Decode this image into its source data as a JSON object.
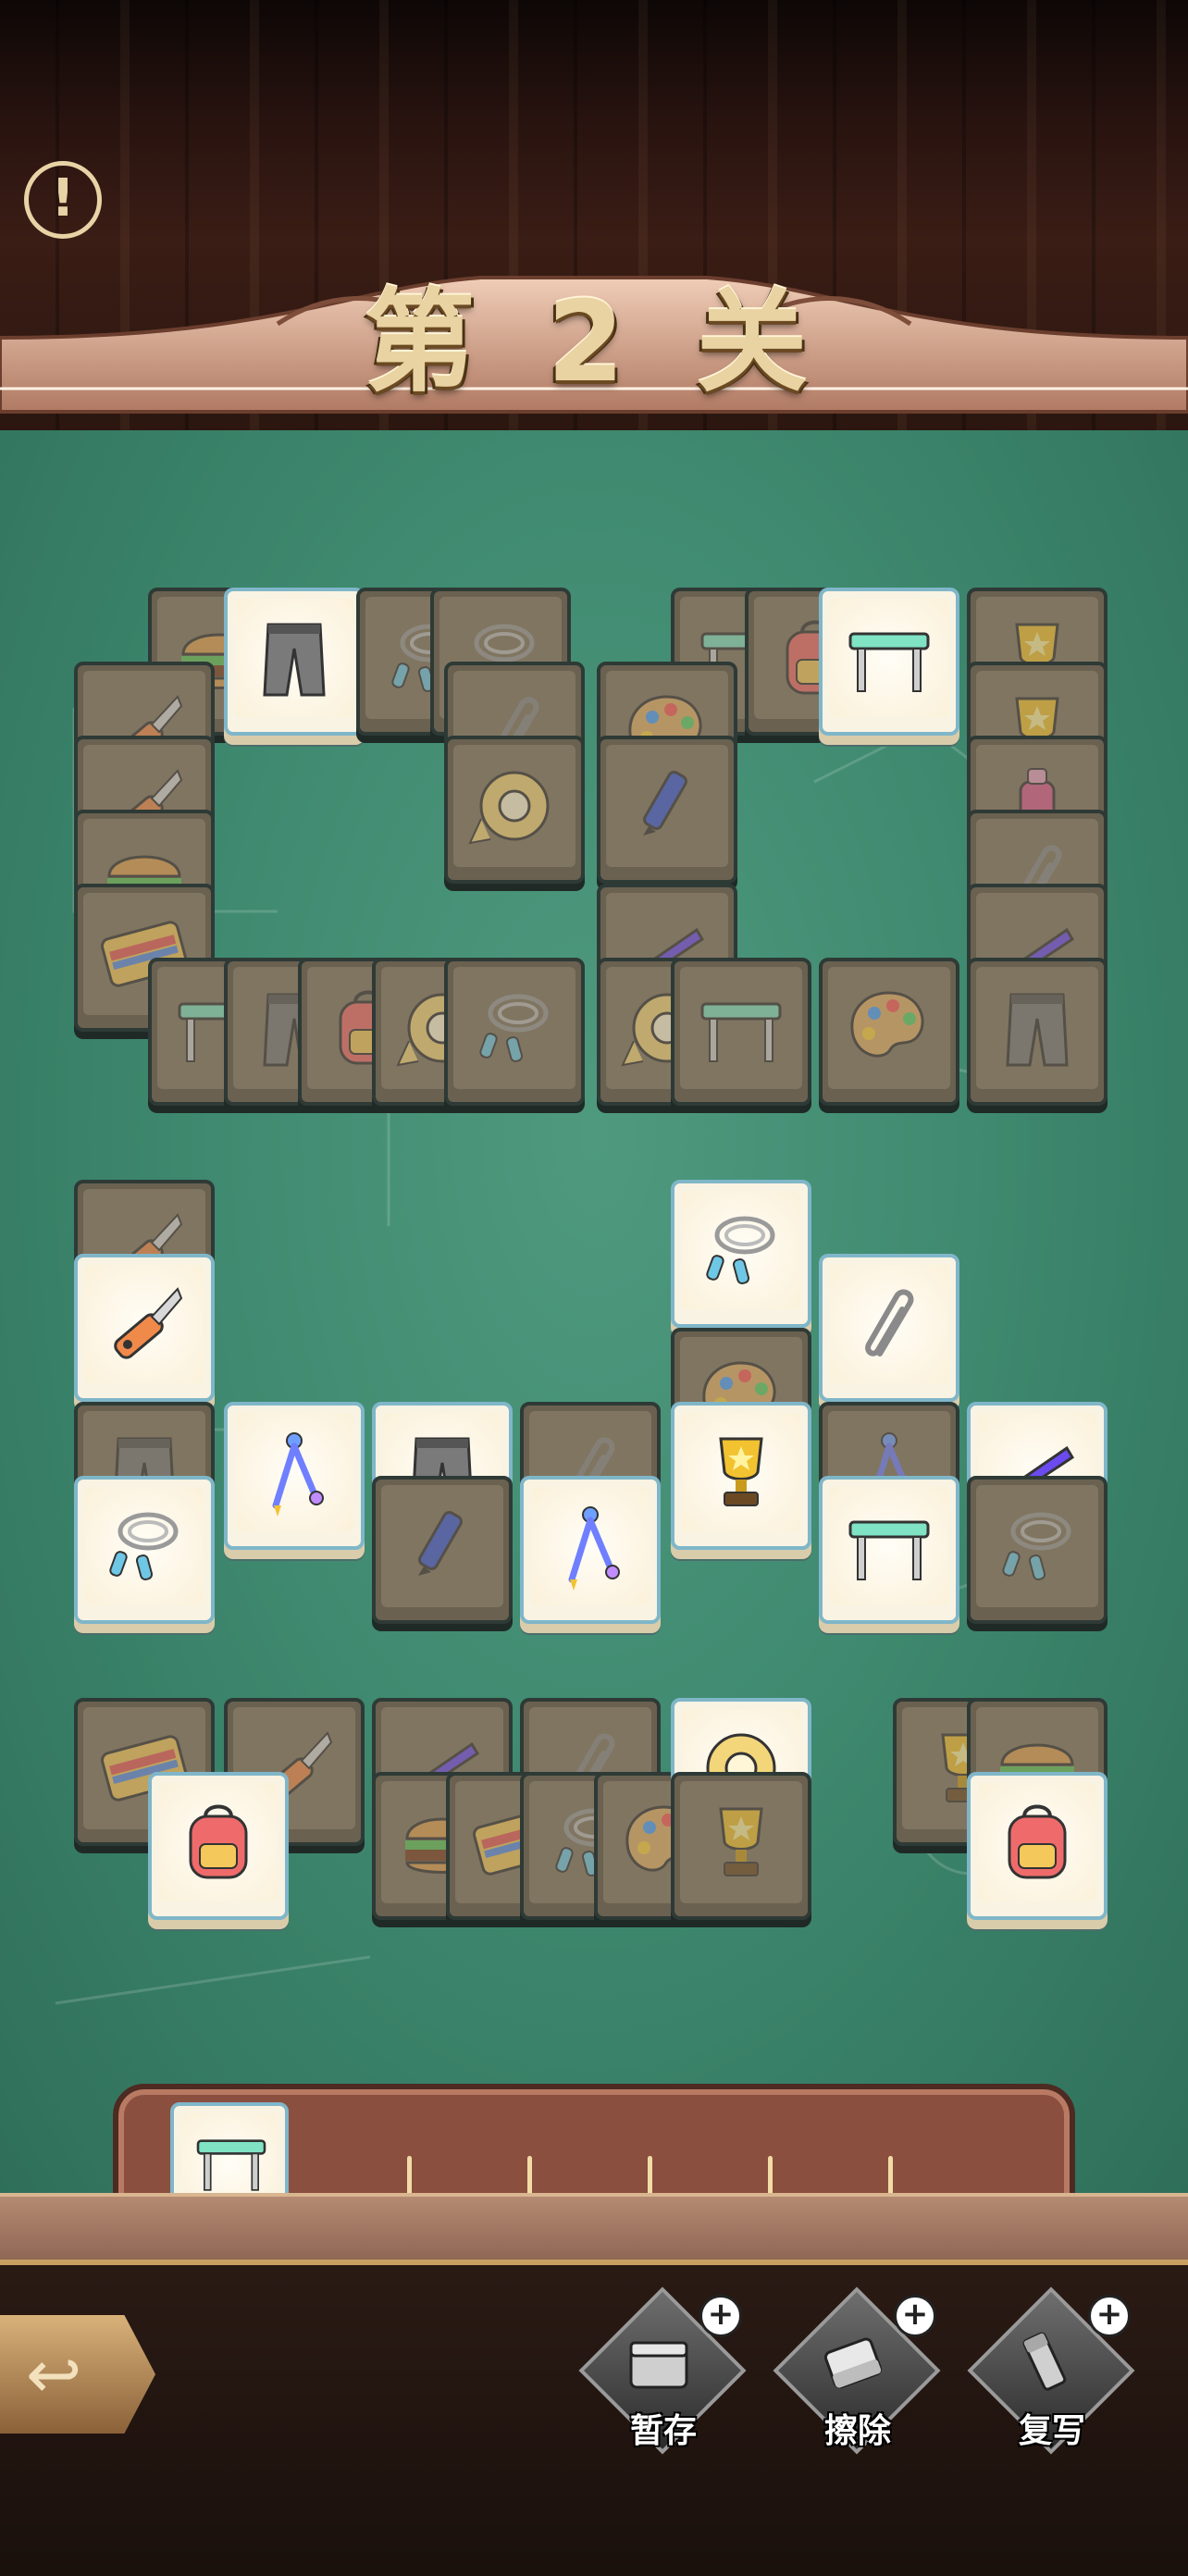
{
  "level": {
    "title": "第 2 关"
  },
  "colors": {
    "board": "#3f8a70",
    "tile_face": "#f9f3e3",
    "tile_border": "#7fb6c9",
    "tray": "#8a4f3e"
  },
  "board": {
    "tiles": [
      {
        "icon": "burger-icon",
        "state": "dim"
      },
      {
        "icon": "pants-icon",
        "state": "lit"
      },
      {
        "icon": "jump-rope-icon",
        "state": "dim"
      },
      {
        "icon": "jump-rope-icon",
        "state": "dim"
      },
      {
        "icon": "desk-icon",
        "state": "dim"
      },
      {
        "icon": "backpack-icon",
        "state": "dim"
      },
      {
        "icon": "desk-icon",
        "state": "lit"
      },
      {
        "icon": "trophy-icon",
        "state": "dim"
      },
      {
        "icon": "cutter-knife-icon",
        "state": "dim"
      },
      {
        "icon": "paperclip-icon",
        "state": "dim"
      },
      {
        "icon": "palette-icon",
        "state": "dim"
      },
      {
        "icon": "trophy-icon",
        "state": "dim"
      },
      {
        "icon": "cutter-knife-icon",
        "state": "dim"
      },
      {
        "icon": "water-bottle-icon",
        "state": "dim"
      },
      {
        "icon": "tape-icon",
        "state": "dim"
      },
      {
        "icon": "pen-icon",
        "state": "dim"
      },
      {
        "icon": "burger-icon",
        "state": "dim"
      },
      {
        "icon": "paperclip-icon",
        "state": "dim"
      },
      {
        "icon": "wallet-icon",
        "state": "dim"
      },
      {
        "icon": "stapler-icon",
        "state": "dim"
      },
      {
        "icon": "stapler-icon",
        "state": "dim"
      },
      {
        "icon": "desk-icon",
        "state": "dim"
      },
      {
        "icon": "pants-icon",
        "state": "dim"
      },
      {
        "icon": "backpack-icon",
        "state": "dim"
      },
      {
        "icon": "tape-icon",
        "state": "dim"
      },
      {
        "icon": "jump-rope-icon",
        "state": "dim"
      },
      {
        "icon": "tape-icon",
        "state": "dim"
      },
      {
        "icon": "desk-icon",
        "state": "dim"
      },
      {
        "icon": "palette-icon",
        "state": "dim"
      },
      {
        "icon": "pants-icon",
        "state": "dim"
      },
      {
        "icon": "cutter-knife-icon",
        "state": "dim"
      },
      {
        "icon": "cutter-knife-icon",
        "state": "lit"
      },
      {
        "icon": "jump-rope-icon",
        "state": "lit"
      },
      {
        "icon": "palette-icon",
        "state": "dim"
      },
      {
        "icon": "paperclip-icon",
        "state": "lit"
      },
      {
        "icon": "pants-icon",
        "state": "dim"
      },
      {
        "icon": "compass-icon",
        "state": "lit"
      },
      {
        "icon": "pants-icon",
        "state": "lit"
      },
      {
        "icon": "paperclip-icon",
        "state": "dim"
      },
      {
        "icon": "trophy-icon",
        "state": "lit"
      },
      {
        "icon": "compass-icon",
        "state": "dim"
      },
      {
        "icon": "stapler-icon",
        "state": "lit"
      },
      {
        "icon": "jump-rope-icon",
        "state": "lit"
      },
      {
        "icon": "pen-icon",
        "state": "dim"
      },
      {
        "icon": "compass-icon",
        "state": "lit"
      },
      {
        "icon": "desk-icon",
        "state": "lit"
      },
      {
        "icon": "jump-rope-icon",
        "state": "dim"
      },
      {
        "icon": "wallet-icon",
        "state": "dim"
      },
      {
        "icon": "cutter-knife-icon",
        "state": "dim"
      },
      {
        "icon": "backpack-icon",
        "state": "lit"
      },
      {
        "icon": "stapler-icon",
        "state": "dim"
      },
      {
        "icon": "paperclip-icon",
        "state": "dim"
      },
      {
        "icon": "burger-icon",
        "state": "dim"
      },
      {
        "icon": "wallet-icon",
        "state": "dim"
      },
      {
        "icon": "jump-rope-icon",
        "state": "dim"
      },
      {
        "icon": "palette-icon",
        "state": "dim"
      },
      {
        "icon": "tape-icon",
        "state": "lit"
      },
      {
        "icon": "trophy-icon",
        "state": "dim"
      },
      {
        "icon": "trophy-icon",
        "state": "dim"
      },
      {
        "icon": "burger-icon",
        "state": "dim"
      },
      {
        "icon": "backpack-icon",
        "state": "lit"
      }
    ]
  },
  "tray": {
    "capacity": 7,
    "items": [
      {
        "icon": "desk-icon"
      }
    ]
  },
  "tools": [
    {
      "label": "暂存",
      "icon": "storage-box-icon"
    },
    {
      "label": "擦除",
      "icon": "eraser-icon"
    },
    {
      "label": "复写",
      "icon": "copy-icon"
    }
  ]
}
